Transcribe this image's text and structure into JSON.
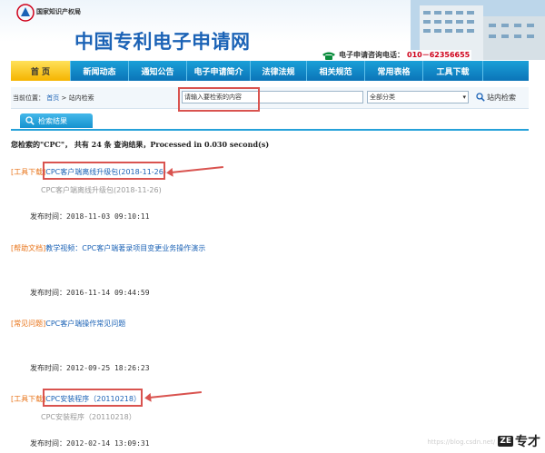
{
  "header": {
    "agency": "国家知识产权局",
    "site_title": "中国专利电子申请网",
    "hotline_label": "电子申请咨询电话：",
    "hotline_number": "010－62356655"
  },
  "nav": {
    "items": [
      {
        "label": "首 页",
        "width": 66
      },
      {
        "label": "新闻动态",
        "width": 64
      },
      {
        "label": "通知公告",
        "width": 64
      },
      {
        "label": "电子申请简介",
        "width": 70
      },
      {
        "label": "法律法规",
        "width": 62
      },
      {
        "label": "相关规范",
        "width": 64
      },
      {
        "label": "常用表格",
        "width": 64
      },
      {
        "label": "工具下载",
        "width": 66
      }
    ]
  },
  "breadcrumb": {
    "prefix": "当前位置：",
    "home": "首页",
    "current": "站内检索"
  },
  "search": {
    "value": "请输入要检索的内容",
    "category": "全部分类",
    "button": "站内检索"
  },
  "results": {
    "tab_label": "检索结果",
    "summary": "您检索的\"CPC\"， 共有 24 条 查询结果，Processed in 0.030 second(s)",
    "date_label": "发布时间：",
    "items": [
      {
        "category": "[工具下载]",
        "title": "CPC客户端离线升级包(2018-11-26)",
        "subtitle": "CPC客户端离线升级包(2018-11-26)",
        "date": "2018-11-03 09:10:11"
      },
      {
        "category": "[帮助文档]",
        "title": "教学视频：CPC客户端著录项目变更业务操作演示",
        "subtitle": "",
        "date": "2016-11-14 09:44:59"
      },
      {
        "category": "[常见问题]",
        "title": "CPC客户端操作常见问题",
        "subtitle": "",
        "date": "2012-09-25 18:26:23"
      },
      {
        "category": "[工具下载]",
        "title": "CPC安装程序（20110218）",
        "subtitle": "CPC安装程序（20110218）",
        "date": "2012-02-14 13:09:31"
      }
    ]
  },
  "footer": {
    "watermark": "https://blog.csdn.net/zh...",
    "badge_text": "专才"
  }
}
